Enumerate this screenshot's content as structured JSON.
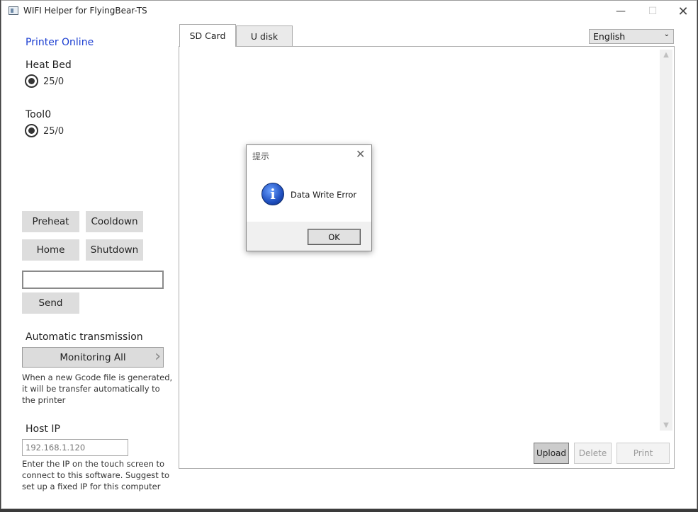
{
  "window": {
    "title": "WIFI Helper for FlyingBear-TS",
    "min_glyph": "—",
    "max_glyph": "☐",
    "close_glyph": "✕"
  },
  "sidebar": {
    "status": "Printer Online",
    "heat_bed": {
      "label": "Heat Bed",
      "value": "25/0"
    },
    "tool0": {
      "label": "Tool0",
      "value": "25/0"
    },
    "buttons": {
      "preheat": "Preheat",
      "cooldown": "Cooldown",
      "home": "Home",
      "shutdown": "Shutdown",
      "send": "Send"
    },
    "command_input": {
      "value": ""
    },
    "auto_transmission": {
      "label": "Automatic transmission",
      "button": "Monitoring All",
      "description_lines": [
        "When a new Gcode file is generated,",
        "it will be transfer automatically  to",
        "the printer"
      ]
    },
    "host_ip": {
      "label": "Host IP",
      "value": "192.168.1.120",
      "description_lines": [
        "Enter the IP on the touch screen to",
        "connect to this software. Suggest to",
        "set up a fixed IP for this computer"
      ]
    }
  },
  "main": {
    "tabs": [
      {
        "label": "SD Card",
        "selected": true
      },
      {
        "label": "U disk",
        "selected": false
      }
    ],
    "language": {
      "selected": "English"
    },
    "actions": {
      "upload": "Upload",
      "delete": "Delete",
      "print": "Print"
    }
  },
  "dialog": {
    "title": "提示",
    "message": "Data Write Error",
    "ok": "OK",
    "icon": "info-icon"
  },
  "colors": {
    "status_online": "#1a3dd1",
    "button_bg": "#dddddd"
  }
}
